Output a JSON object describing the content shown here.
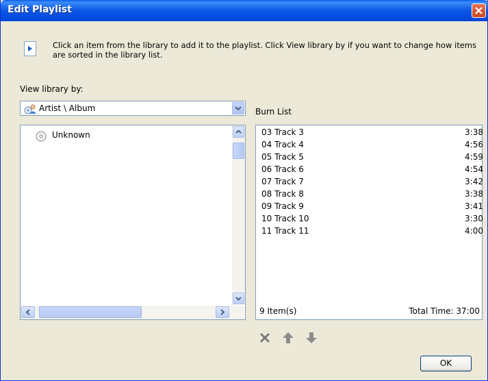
{
  "window": {
    "title": "Edit Playlist"
  },
  "info": {
    "text": "Click an item from the library to add it to the playlist. Click View library by if you want to change how items are sorted in the library list."
  },
  "library": {
    "view_by_label": "View library by:",
    "selected_view": "Artist \\ Album",
    "items": [
      "Unknown"
    ]
  },
  "burn_list": {
    "label": "Burn List",
    "tracks": [
      {
        "name": "03 Track 3",
        "duration": "3:38"
      },
      {
        "name": "04 Track 4",
        "duration": "4:56"
      },
      {
        "name": "05 Track 5",
        "duration": "4:59"
      },
      {
        "name": "06 Track 6",
        "duration": "4:54"
      },
      {
        "name": "07 Track 7",
        "duration": "3:42"
      },
      {
        "name": "08 Track 8",
        "duration": "3:38"
      },
      {
        "name": "09 Track 9",
        "duration": "3:41"
      },
      {
        "name": "10 Track 10",
        "duration": "3:30"
      },
      {
        "name": "11 Track 11",
        "duration": "4:00"
      }
    ],
    "item_count": "9 Item(s)",
    "total_time": "Total Time: 37:00"
  },
  "buttons": {
    "ok": "OK"
  },
  "icons": [
    "info-icon",
    "close-icon",
    "artist-album-icon",
    "cd-icon",
    "remove-icon",
    "move-up-icon",
    "move-down-icon"
  ]
}
